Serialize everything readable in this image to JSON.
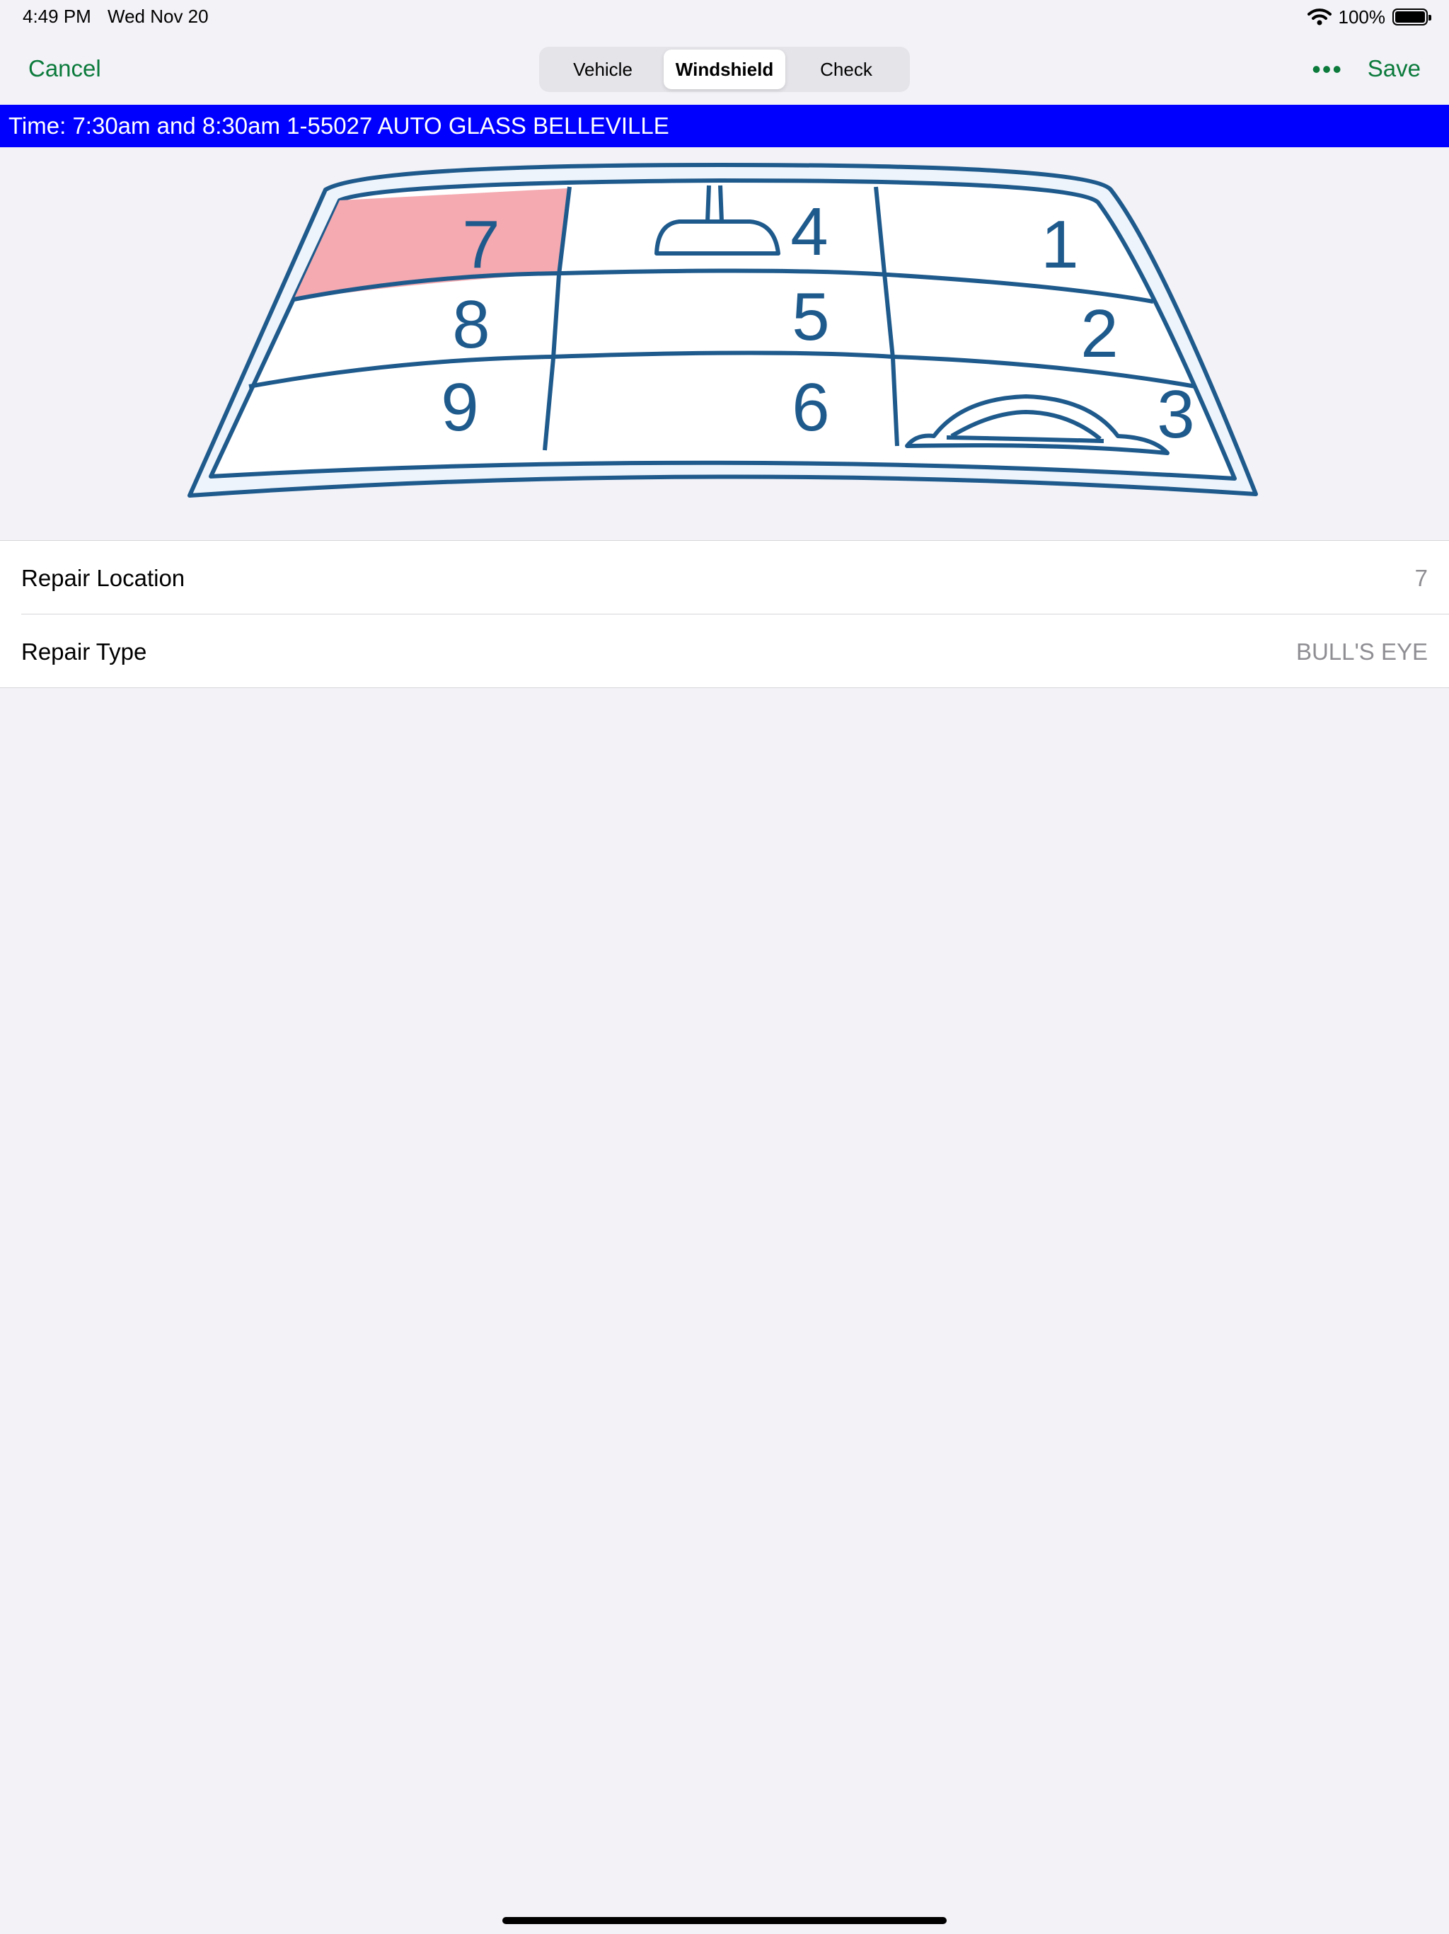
{
  "status": {
    "time": "4:49 PM",
    "date": "Wed Nov 20",
    "battery": "100%"
  },
  "nav": {
    "cancel": "Cancel",
    "save": "Save",
    "more": "•••",
    "tabs": [
      "Vehicle",
      "Windshield",
      "Check"
    ],
    "active_tab": "Windshield",
    "accent_color": "#0b7a3b"
  },
  "banner": {
    "text": "Time: 7:30am and 8:30am 1-55027 AUTO GLASS BELLEVILLE",
    "color": "#0000ff"
  },
  "windshield": {
    "zones": [
      "1",
      "2",
      "3",
      "4",
      "5",
      "6",
      "7",
      "8",
      "9"
    ],
    "selected_zone": "7",
    "highlight_color": "#f4aab0",
    "line_color": "#1f5a8c"
  },
  "details": {
    "repair_location_label": "Repair Location",
    "repair_location_value": "7",
    "repair_type_label": "Repair Type",
    "repair_type_value": "BULL'S EYE"
  }
}
